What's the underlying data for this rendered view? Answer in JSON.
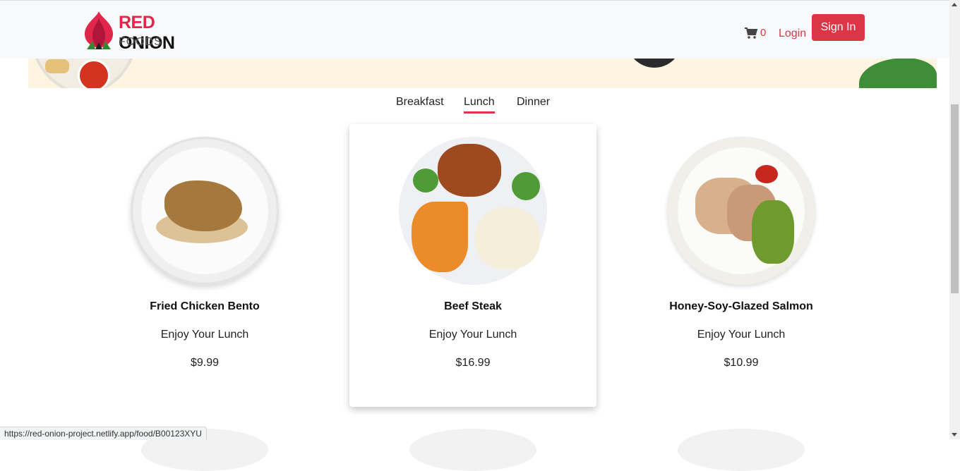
{
  "header": {
    "logo": {
      "brand_red": "RED",
      "brand_dark": "ONION",
      "sub": "FOODS"
    },
    "cart": {
      "icon": "shopping-cart-icon",
      "count": "0"
    },
    "login_label": "Login",
    "signin_label": "Sign In"
  },
  "tabs": [
    {
      "label": "Breakfast",
      "active": false
    },
    {
      "label": "Lunch",
      "active": true
    },
    {
      "label": "Dinner",
      "active": false
    }
  ],
  "foods": [
    {
      "name": "Fried Chicken Bento",
      "description": "Enjoy Your Lunch",
      "price": "$9.99"
    },
    {
      "name": "Beef Steak",
      "description": "Enjoy Your Lunch",
      "price": "$16.99"
    },
    {
      "name": "Honey-Soy-Glazed Salmon",
      "description": "Enjoy Your Lunch",
      "price": "$10.99"
    }
  ],
  "status_url": "https://red-onion-project.netlify.app/food/B00123XYU",
  "colors": {
    "accent": "#dc3545",
    "brand_red": "#e0264a",
    "hero_bg": "#fdf4e1"
  }
}
